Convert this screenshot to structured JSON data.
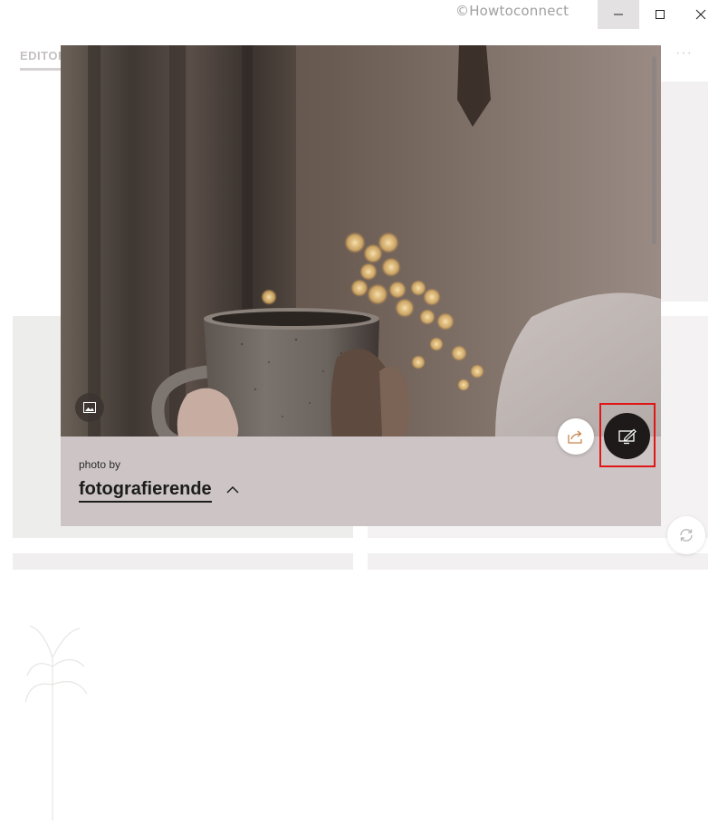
{
  "window": {
    "watermark": "©Howtoconnect",
    "controls": [
      "minimize-icon",
      "maximize-icon",
      "close-icon"
    ]
  },
  "background_app": {
    "tab_label": "EDITOR",
    "more_label": "···"
  },
  "photo_card": {
    "credit_label": "photo by",
    "photographer": "fotografierende",
    "icons": {
      "image_badge": "image-icon",
      "collapse": "chevron-up-icon",
      "share": "share-icon",
      "set_background": "set-as-background-icon",
      "refresh": "refresh-icon"
    }
  },
  "colors": {
    "card_background": "#cdc5c5",
    "highlight": "#e01515",
    "action_button": "#1d1a19"
  }
}
